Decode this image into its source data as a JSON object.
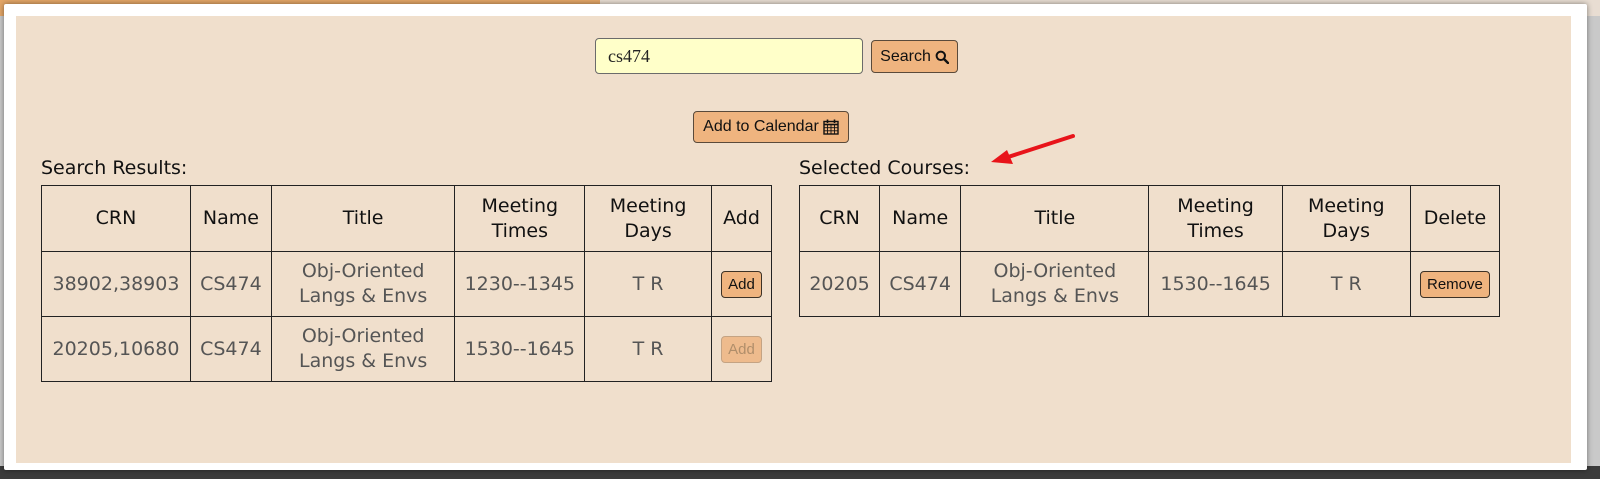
{
  "search": {
    "query": "cs474",
    "button_label": "Search",
    "button_icon": "search-icon"
  },
  "calendar": {
    "button_label": "Add to Calendar",
    "button_icon": "calendar-icon"
  },
  "results": {
    "label": "Search Results:",
    "columns": [
      "CRN",
      "Name",
      "Title",
      "Meeting Times",
      "Meeting Days",
      "Add"
    ],
    "rows": [
      {
        "crn": "38902,38903",
        "name": "CS474",
        "title": "Obj-Oriented Langs & Envs",
        "times": "1230--1345",
        "days": "T R",
        "action": "Add",
        "enabled": true
      },
      {
        "crn": "20205,10680",
        "name": "CS474",
        "title": "Obj-Oriented Langs & Envs",
        "times": "1530--1645",
        "days": "T R",
        "action": "Add",
        "enabled": false
      }
    ]
  },
  "selected": {
    "label": "Selected Courses:",
    "columns": [
      "CRN",
      "Name",
      "Title",
      "Meeting Times",
      "Meeting Days",
      "Delete"
    ],
    "rows": [
      {
        "crn": "20205",
        "name": "CS474",
        "title": "Obj-Oriented Langs & Envs",
        "times": "1530--1645",
        "days": "T R",
        "action": "Remove"
      }
    ]
  },
  "colors": {
    "panel_bg": "#f0dfcc",
    "button_bg": "#efb47f",
    "input_bg": "#ffffc9",
    "arrow": "#e8141a"
  }
}
